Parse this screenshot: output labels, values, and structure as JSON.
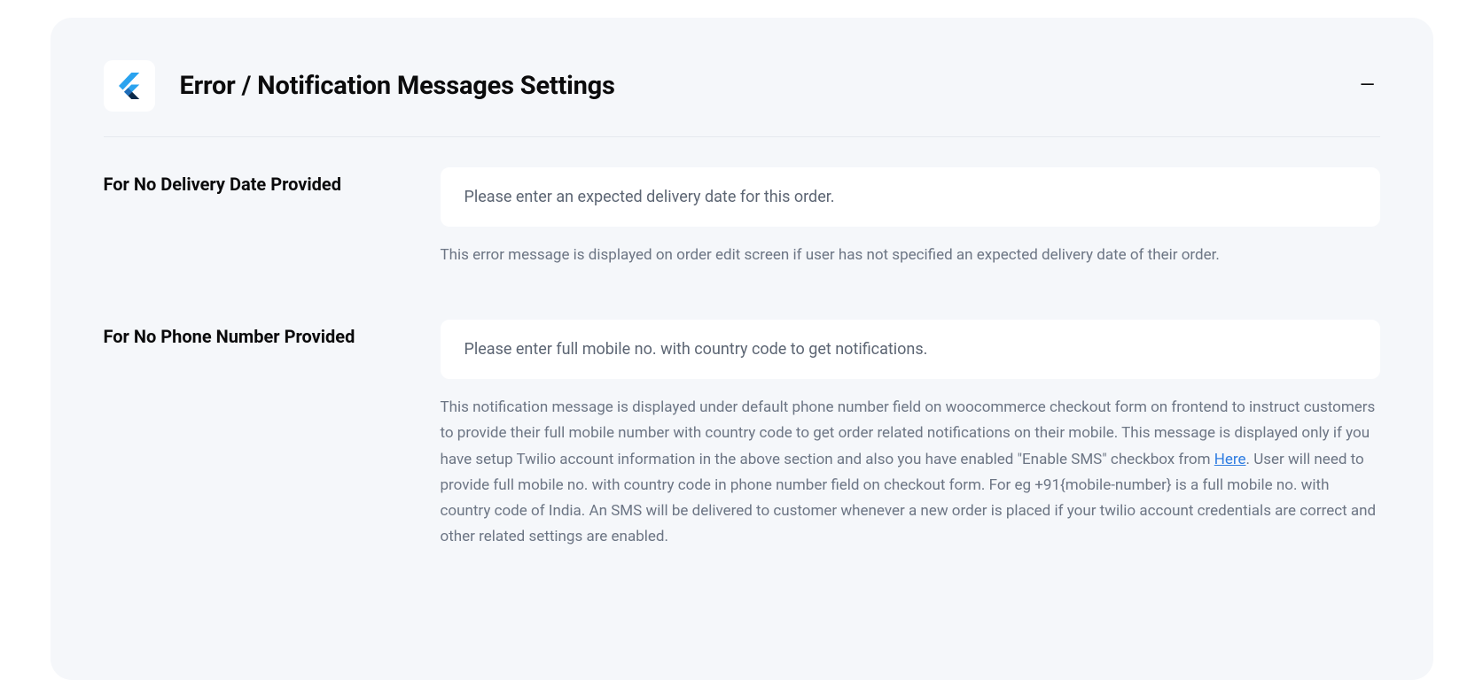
{
  "panel": {
    "title": "Error / Notification Messages Settings",
    "collapse_glyph": "—"
  },
  "settings": {
    "no_delivery_date": {
      "label": "For No Delivery Date Provided",
      "value": "Please enter an expected delivery date for this order.",
      "help": "This error message is displayed on order edit screen if user has not specified an expected delivery date of their order."
    },
    "no_phone": {
      "label": "For No Phone Number Provided",
      "value": "Please enter full mobile no. with country code to get notifications.",
      "help_pre": "This notification message is displayed under default phone number field on woocommerce checkout form on frontend to instruct customers to provide their full mobile number with country code to get order related notifications on their mobile. This message is displayed only if you have setup Twilio account information in the above section and also you have enabled \"Enable SMS\" checkbox from ",
      "help_link_text": "Here",
      "help_post": ". User will need to provide full mobile no. with country code in phone number field on checkout form. For eg +91{mobile-number} is a full mobile no. with country code of India. An SMS will be delivered to customer whenever a new order is placed if your twilio account credentials are correct and other related settings are enabled."
    }
  }
}
